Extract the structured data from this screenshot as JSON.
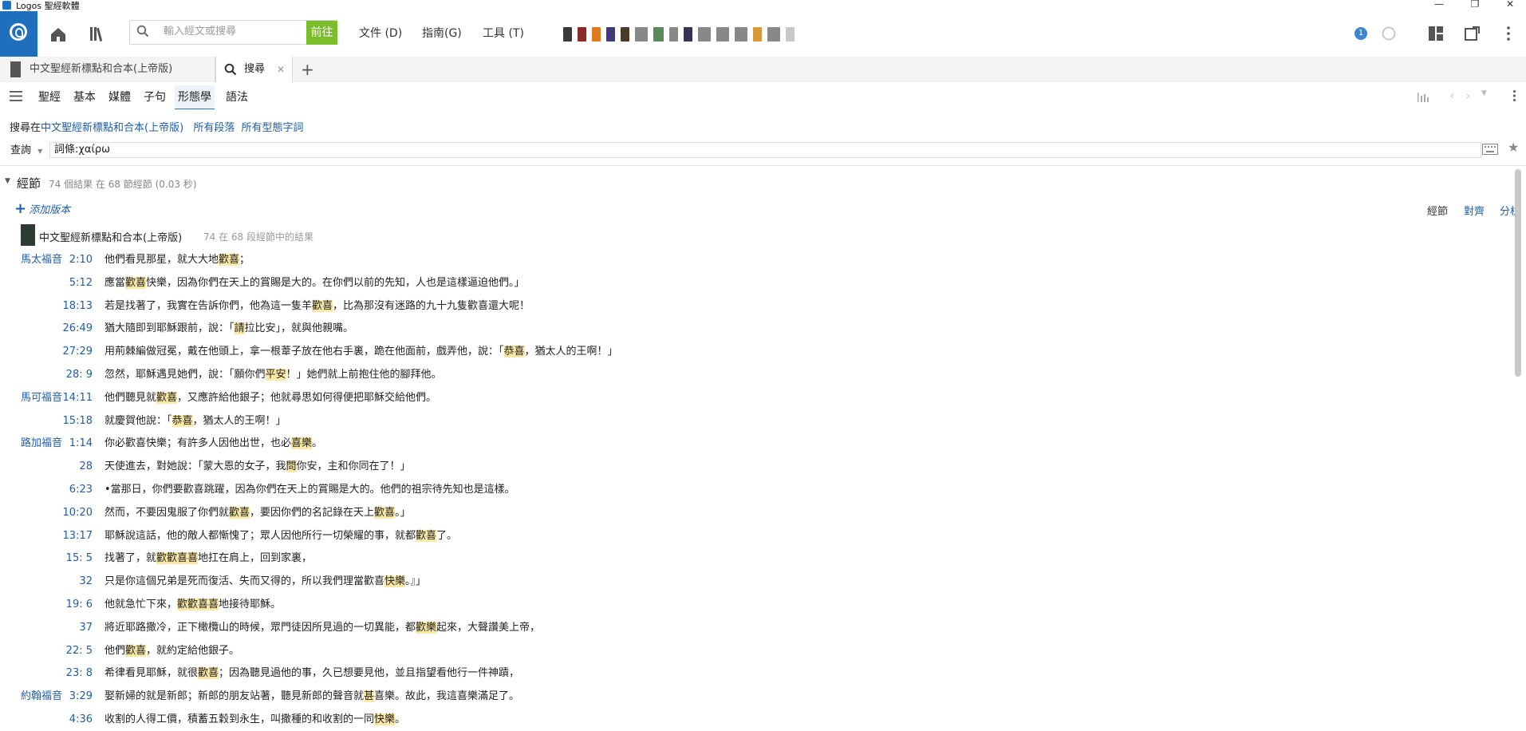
{
  "window": {
    "title": "Logos 聖經軟體",
    "minimize": "—",
    "restore": "❐",
    "close": "✕"
  },
  "toolbar": {
    "search_placeholder": "輸入經文或搜尋",
    "go_label": "前往",
    "menus": [
      "文件 (D)",
      "指南(G)",
      "工具 (T)"
    ],
    "notification_count": "1"
  },
  "shelf_colors": [
    "#3a3a3a",
    "#8a2a2a",
    "#e07a1f",
    "#3f3a7a",
    "#4a3a2a",
    "#888888",
    "#5a8a5a",
    "#888888",
    "#333355",
    "#888888",
    "#888888",
    "#888888",
    "#d69a3a",
    "#888888",
    "#c8c8c8"
  ],
  "tabs": [
    {
      "label": "中文聖經新標點和合本(上帝版)"
    },
    {
      "label": "搜尋",
      "close": "✕"
    }
  ],
  "add_tab": "+",
  "search_nav": {
    "items": [
      "聖經",
      "基本",
      "媒體",
      "子句",
      "形態學",
      "語法"
    ],
    "active_index": 4
  },
  "query": {
    "scope_prefix": "搜尋在",
    "scope_resource": "中文聖經新標點和合本(上帝版)",
    "scope_passages": "所有段落",
    "scope_forms": "所有型態字詞",
    "query_label": "查詢",
    "query_value": "詞條:χαίρω"
  },
  "results": {
    "section_title": "經節",
    "summary": "74 個結果 在 68 節經節 (0.03 秒)",
    "add_version": "添加版本",
    "view_buttons": [
      "經節",
      "對齊",
      "分析"
    ],
    "resource_name": "中文聖經新標點和合本(上帝版)",
    "resource_summary": "74 在 68 段經節中的結果"
  },
  "verses": [
    {
      "book": "馬太福音",
      "ref": "2:10",
      "segs": [
        [
          "他們看見那星，就大大地",
          0
        ],
        [
          "歡喜",
          1
        ],
        [
          "；",
          0
        ]
      ]
    },
    {
      "book": "",
      "ref": "5:12",
      "segs": [
        [
          "應當",
          0
        ],
        [
          "歡喜",
          1
        ],
        [
          "快樂，因為你們在天上的賞賜是大的。在你們以前的先知，人也是這樣逼迫他們。」",
          0
        ]
      ]
    },
    {
      "book": "",
      "ref": "18:13",
      "segs": [
        [
          "若是找著了，我實在告訴你們，他為這一隻羊",
          0
        ],
        [
          "歡喜",
          1
        ],
        [
          "，比為那沒有迷路的九十九隻歡喜還大呢！",
          0
        ]
      ]
    },
    {
      "book": "",
      "ref": "26:49",
      "segs": [
        [
          "猶大隨即到耶穌跟前，說：「",
          0
        ],
        [
          "請",
          1
        ],
        [
          "拉比安」，就與他親嘴。",
          0
        ]
      ]
    },
    {
      "book": "",
      "ref": "27:29",
      "segs": [
        [
          "用荊棘編做冠冕，戴在他頭上，拿一根葦子放在他右手裏，跪在他面前，戲弄他，說：「",
          0
        ],
        [
          "恭喜",
          1
        ],
        [
          "，猶太人的王啊！」",
          0
        ]
      ]
    },
    {
      "book": "",
      "ref": "28: 9",
      "segs": [
        [
          "忽然，耶穌遇見她們，說：「願你們",
          0
        ],
        [
          "平安",
          1
        ],
        [
          "！」她們就上前抱住他的腳拜他。",
          0
        ]
      ]
    },
    {
      "book": "馬可福音",
      "ref": "14:11",
      "segs": [
        [
          "他們聽見就",
          0
        ],
        [
          "歡喜",
          1
        ],
        [
          "，又應許給他銀子；他就尋思如何得便把耶穌交給他們。",
          0
        ]
      ]
    },
    {
      "book": "",
      "ref": "15:18",
      "segs": [
        [
          "就慶賀他說：「",
          0
        ],
        [
          "恭喜",
          1
        ],
        [
          "，猶太人的王啊！」",
          0
        ]
      ]
    },
    {
      "book": "路加福音",
      "ref": "1:14",
      "segs": [
        [
          "你必歡喜快樂；有許多人因他出世，也必",
          0
        ],
        [
          "喜樂",
          1
        ],
        [
          "。",
          0
        ]
      ]
    },
    {
      "book": "",
      "ref": "28",
      "segs": [
        [
          "天使進去，對她說：「蒙大恩的女子，我",
          0
        ],
        [
          "問",
          1
        ],
        [
          "你安，主和你同在了！」",
          0
        ]
      ]
    },
    {
      "book": "",
      "ref": "6:23",
      "segs": [
        [
          "•當那日，你們要歡喜跳躍，因為你們在天上的賞賜是大的。他們的祖宗待先知也是這樣。",
          0
        ]
      ]
    },
    {
      "book": "",
      "ref": "10:20",
      "segs": [
        [
          "然而，不要因鬼服了你們就",
          0
        ],
        [
          "歡喜",
          1
        ],
        [
          "，要因你們的名記錄在天上",
          0
        ],
        [
          "歡喜",
          1
        ],
        [
          "。」",
          0
        ]
      ]
    },
    {
      "book": "",
      "ref": "13:17",
      "segs": [
        [
          "耶穌說這話，他的敵人都慚愧了；眾人因他所行一切榮耀的事，就都",
          0
        ],
        [
          "歡喜",
          1
        ],
        [
          "了。",
          0
        ]
      ]
    },
    {
      "book": "",
      "ref": "15: 5",
      "segs": [
        [
          "找著了，就",
          0
        ],
        [
          "歡歡喜喜",
          1
        ],
        [
          "地扛在肩上，回到家裏，",
          0
        ]
      ]
    },
    {
      "book": "",
      "ref": "32",
      "segs": [
        [
          "只是你這個兄弟是死而復活、失而又得的，所以我們理當歡喜",
          0
        ],
        [
          "快樂",
          1
        ],
        [
          "。』」",
          0
        ]
      ]
    },
    {
      "book": "",
      "ref": "19: 6",
      "segs": [
        [
          "他就急忙下來，",
          0
        ],
        [
          "歡歡喜喜",
          1
        ],
        [
          "地接待耶穌。",
          0
        ]
      ]
    },
    {
      "book": "",
      "ref": "37",
      "segs": [
        [
          "將近耶路撒冷，正下橄欖山的時候，眾門徒因所見過的一切異能，都",
          0
        ],
        [
          "歡樂",
          1
        ],
        [
          "起來，大聲讚美上帝，",
          0
        ]
      ]
    },
    {
      "book": "",
      "ref": "22: 5",
      "segs": [
        [
          "他們",
          0
        ],
        [
          "歡喜",
          1
        ],
        [
          "，就約定給他銀子。",
          0
        ]
      ]
    },
    {
      "book": "",
      "ref": "23: 8",
      "segs": [
        [
          "希律看見耶穌，就很",
          0
        ],
        [
          "歡喜",
          1
        ],
        [
          "；因為聽見過他的事，久已想要見他，並且指望看他行一件神蹟，",
          0
        ]
      ]
    },
    {
      "book": "約翰福音",
      "ref": "3:29",
      "segs": [
        [
          "娶新婦的就是新郎；新郎的朋友站著，聽見新郎的聲音就",
          0
        ],
        [
          "甚",
          1
        ],
        [
          "喜樂。故此，我這喜樂滿足了。",
          0
        ]
      ]
    },
    {
      "book": "",
      "ref": "4:36",
      "segs": [
        [
          "收割的人得工價，積蓄五穀到永生，叫撒種的和收割的一同",
          0
        ],
        [
          "快樂",
          1
        ],
        [
          "。",
          0
        ]
      ]
    }
  ]
}
